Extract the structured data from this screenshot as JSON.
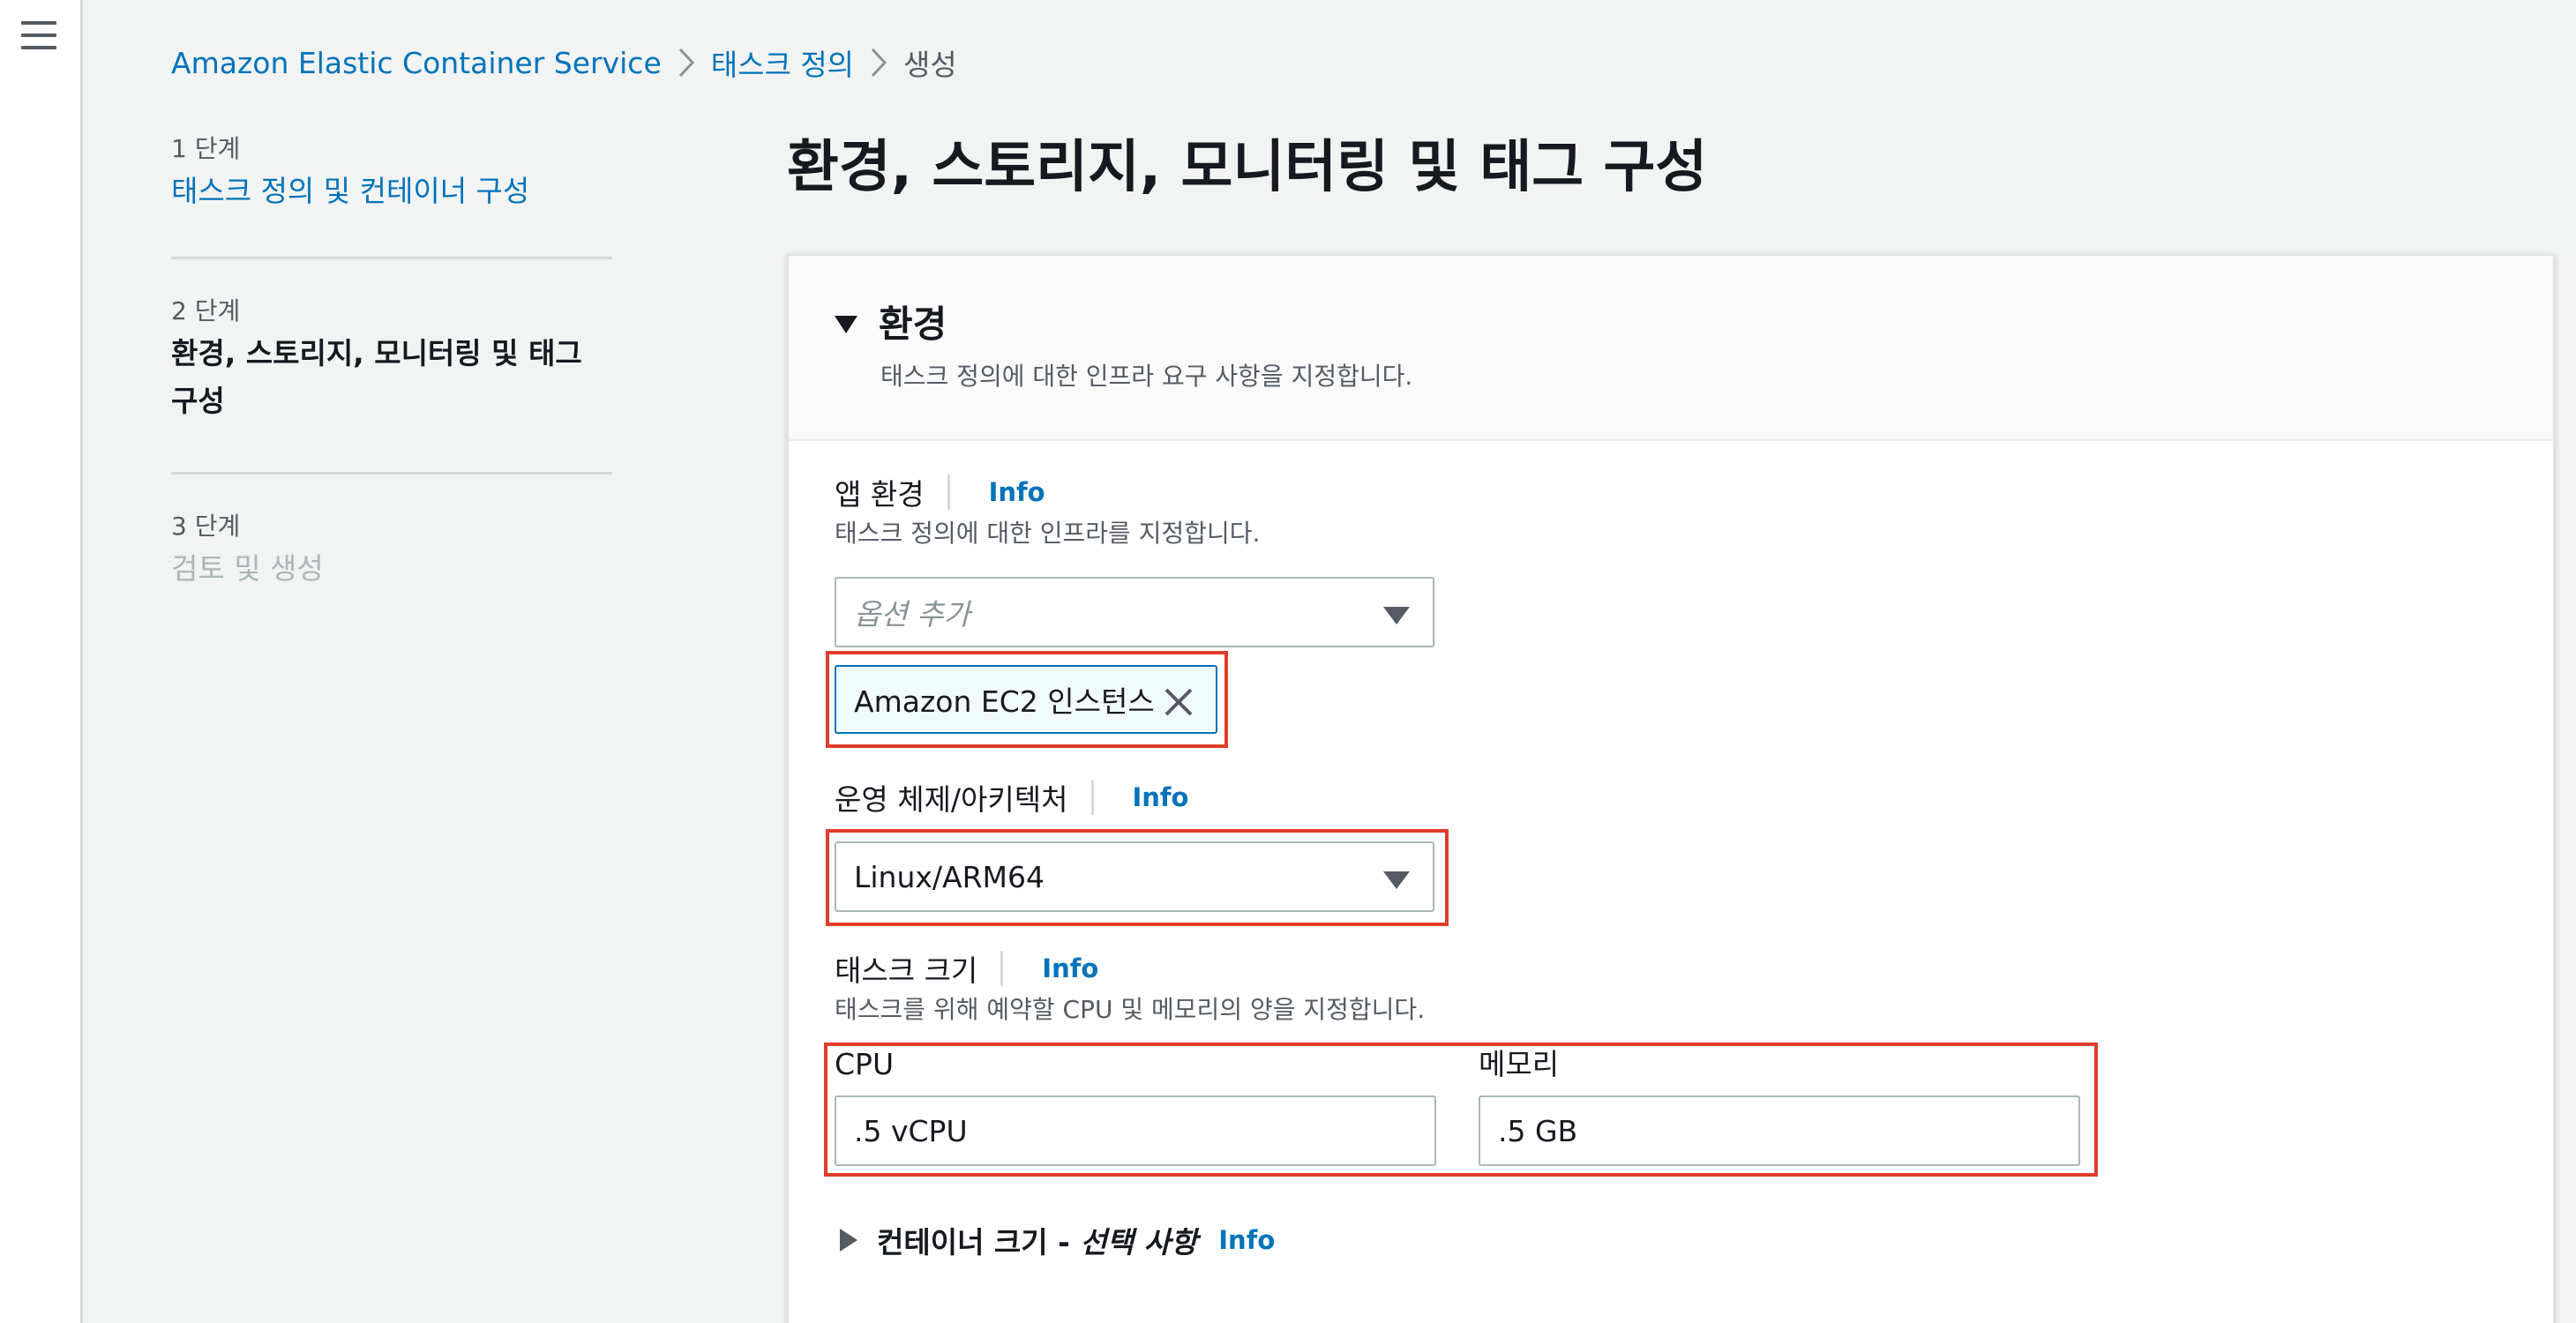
{
  "breadcrumb": {
    "items": [
      "Amazon Elastic Container Service",
      "태스크 정의",
      "생성"
    ]
  },
  "steps": [
    {
      "number": "1 단계",
      "title": "태스크 정의 및 컨테이너 구성"
    },
    {
      "number": "2 단계",
      "title": "환경, 스토리지, 모니터링 및 태그 구성"
    },
    {
      "number": "3 단계",
      "title": "검토 및 생성"
    }
  ],
  "page": {
    "title": "환경, 스토리지, 모니터링 및 태그 구성"
  },
  "environment": {
    "section_title": "환경",
    "section_description": "태스크 정의에 대한 인프라 요구 사항을 지정합니다.",
    "app_env": {
      "label": "앱 환경",
      "info": "Info",
      "description": "태스크 정의에 대한 인프라를 지정합니다.",
      "placeholder": "옵션 추가",
      "selected_token": "Amazon EC2 인스턴스"
    },
    "os_arch": {
      "label": "운영 체제/아키텍처",
      "info": "Info",
      "value": "Linux/ARM64"
    },
    "task_size": {
      "label": "태스크 크기",
      "info": "Info",
      "description": "태스크를 위해 예약할 CPU 및 메모리의 양을 지정합니다.",
      "cpu_label": "CPU",
      "cpu_value": ".5 vCPU",
      "memory_label": "메모리",
      "memory_value": ".5 GB"
    },
    "container_size": {
      "title": "컨테이너 크기 - ",
      "optional": "선택 사항",
      "info": "Info"
    }
  },
  "colors": {
    "link": "#0073bb",
    "highlight": "#e03c2a",
    "background": "#f2f3f3"
  }
}
